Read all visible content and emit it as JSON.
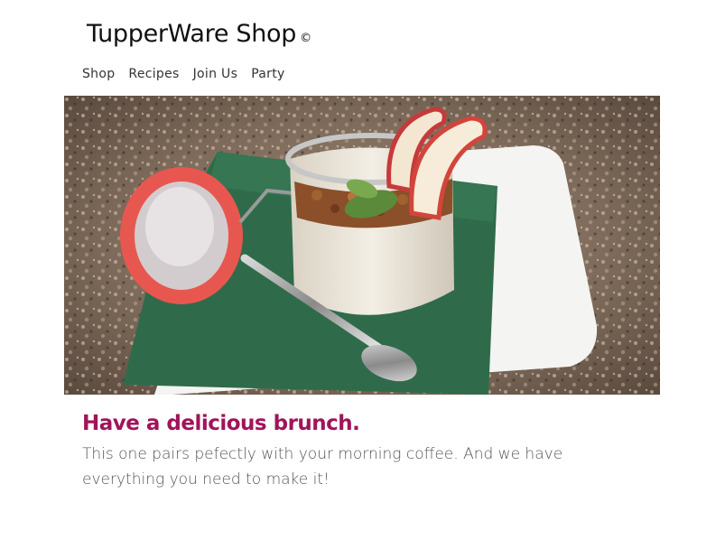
{
  "header": {
    "title": "TupperWare Shop",
    "copyright_symbol": "©"
  },
  "nav": {
    "items": [
      {
        "label": "Shop"
      },
      {
        "label": "Recipes"
      },
      {
        "label": "Join Us"
      },
      {
        "label": "Party"
      }
    ]
  },
  "hero": {
    "image_subject": "glass jar parfait with granola, apple slices and mint on green napkin with spoon"
  },
  "article": {
    "headline": "Have a delicious brunch.",
    "body": "This one pairs pefectly with your morning coffee. And we have everything you need to make it!"
  },
  "colors": {
    "headline": "#a0145a",
    "body_text": "#555555",
    "nav_text": "#333333"
  }
}
